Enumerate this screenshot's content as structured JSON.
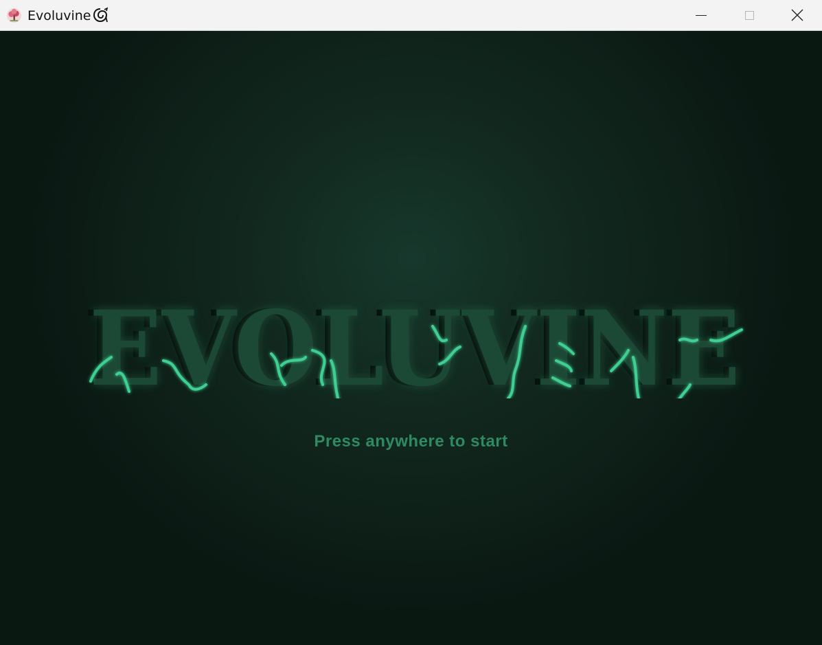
{
  "window": {
    "title": "Evoluvine",
    "app_icon": "tree-icon",
    "title_glyph": "vine-swirl-icon",
    "controls": [
      "minimize-icon",
      "maximize-icon",
      "close-icon"
    ]
  },
  "game": {
    "logo_text": "EVOLUVINE",
    "prompt": "Press anywhere to start",
    "colors": {
      "background": "#12291f",
      "logo_fill": "#1b4a36",
      "logo_shadow": "#061009",
      "vine": "#3fcf92",
      "prompt": "#2f8a62"
    }
  }
}
